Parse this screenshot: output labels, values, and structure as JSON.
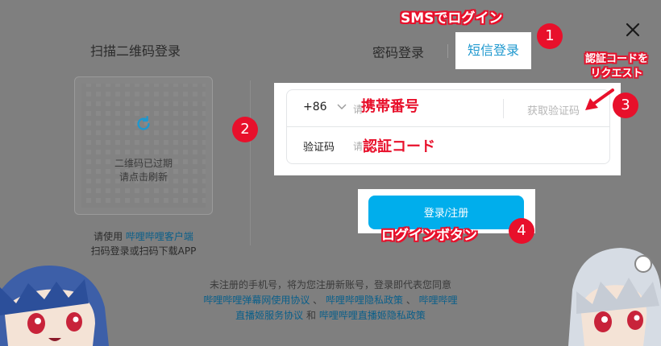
{
  "qr": {
    "title": "扫描二维码登录",
    "expired_line1": "二维码已过期",
    "expired_line2": "请点击刷新",
    "note_prefix": "请使用 ",
    "note_link": "哔哩哔哩客户端",
    "note_line2": "扫码登录或扫码下载APP"
  },
  "tabs": {
    "password": "密码登录",
    "sms": "短信登录"
  },
  "form": {
    "country_code": "+86",
    "phone_placeholder": "请",
    "get_code": "获取验证码",
    "code_label": "验证码",
    "code_placeholder": "请"
  },
  "login_button": "登录/注册",
  "footer": {
    "line1": "未注册的手机号，将为您注册新账号，登录即代表您同意",
    "agreement1": "哔哩哔哩弹幕网使用协议",
    "sep1": " 、 ",
    "agreement2": "哔哩哔哩隐私政策",
    "sep2": " 、 ",
    "agreement3_a": "哔哩哔哩",
    "agreement3_b": "直播姬服务协议",
    "and": " 和 ",
    "agreement4": "哔哩哔哩直播姬隐私政策"
  },
  "annotations": {
    "sms_login": "SMSでログイン",
    "phone": "携帯番号",
    "code": "認証コード",
    "request_line1": "認証コードを",
    "request_line2": "リクエスト",
    "login_button": "ログインボタン",
    "badge1": "1",
    "badge2": "2",
    "badge3": "3",
    "badge4": "4"
  },
  "colors": {
    "accent": "#00aeec",
    "annotation": "#e8102b",
    "link": "#0a5f8a"
  }
}
